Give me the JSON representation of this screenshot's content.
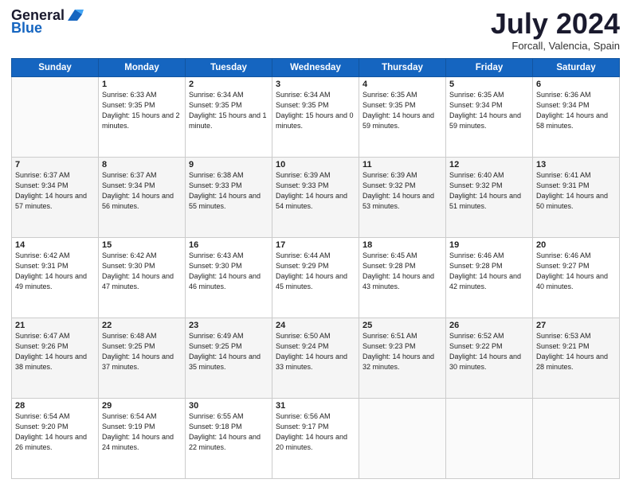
{
  "header": {
    "logo_general": "General",
    "logo_blue": "Blue",
    "month_title": "July 2024",
    "location": "Forcall, Valencia, Spain"
  },
  "days_of_week": [
    "Sunday",
    "Monday",
    "Tuesday",
    "Wednesday",
    "Thursday",
    "Friday",
    "Saturday"
  ],
  "weeks": [
    [
      {
        "day": "",
        "sunrise": "",
        "sunset": "",
        "daylight": ""
      },
      {
        "day": "1",
        "sunrise": "Sunrise: 6:33 AM",
        "sunset": "Sunset: 9:35 PM",
        "daylight": "Daylight: 15 hours and 2 minutes."
      },
      {
        "day": "2",
        "sunrise": "Sunrise: 6:34 AM",
        "sunset": "Sunset: 9:35 PM",
        "daylight": "Daylight: 15 hours and 1 minute."
      },
      {
        "day": "3",
        "sunrise": "Sunrise: 6:34 AM",
        "sunset": "Sunset: 9:35 PM",
        "daylight": "Daylight: 15 hours and 0 minutes."
      },
      {
        "day": "4",
        "sunrise": "Sunrise: 6:35 AM",
        "sunset": "Sunset: 9:35 PM",
        "daylight": "Daylight: 14 hours and 59 minutes."
      },
      {
        "day": "5",
        "sunrise": "Sunrise: 6:35 AM",
        "sunset": "Sunset: 9:34 PM",
        "daylight": "Daylight: 14 hours and 59 minutes."
      },
      {
        "day": "6",
        "sunrise": "Sunrise: 6:36 AM",
        "sunset": "Sunset: 9:34 PM",
        "daylight": "Daylight: 14 hours and 58 minutes."
      }
    ],
    [
      {
        "day": "7",
        "sunrise": "Sunrise: 6:37 AM",
        "sunset": "Sunset: 9:34 PM",
        "daylight": "Daylight: 14 hours and 57 minutes."
      },
      {
        "day": "8",
        "sunrise": "Sunrise: 6:37 AM",
        "sunset": "Sunset: 9:34 PM",
        "daylight": "Daylight: 14 hours and 56 minutes."
      },
      {
        "day": "9",
        "sunrise": "Sunrise: 6:38 AM",
        "sunset": "Sunset: 9:33 PM",
        "daylight": "Daylight: 14 hours and 55 minutes."
      },
      {
        "day": "10",
        "sunrise": "Sunrise: 6:39 AM",
        "sunset": "Sunset: 9:33 PM",
        "daylight": "Daylight: 14 hours and 54 minutes."
      },
      {
        "day": "11",
        "sunrise": "Sunrise: 6:39 AM",
        "sunset": "Sunset: 9:32 PM",
        "daylight": "Daylight: 14 hours and 53 minutes."
      },
      {
        "day": "12",
        "sunrise": "Sunrise: 6:40 AM",
        "sunset": "Sunset: 9:32 PM",
        "daylight": "Daylight: 14 hours and 51 minutes."
      },
      {
        "day": "13",
        "sunrise": "Sunrise: 6:41 AM",
        "sunset": "Sunset: 9:31 PM",
        "daylight": "Daylight: 14 hours and 50 minutes."
      }
    ],
    [
      {
        "day": "14",
        "sunrise": "Sunrise: 6:42 AM",
        "sunset": "Sunset: 9:31 PM",
        "daylight": "Daylight: 14 hours and 49 minutes."
      },
      {
        "day": "15",
        "sunrise": "Sunrise: 6:42 AM",
        "sunset": "Sunset: 9:30 PM",
        "daylight": "Daylight: 14 hours and 47 minutes."
      },
      {
        "day": "16",
        "sunrise": "Sunrise: 6:43 AM",
        "sunset": "Sunset: 9:30 PM",
        "daylight": "Daylight: 14 hours and 46 minutes."
      },
      {
        "day": "17",
        "sunrise": "Sunrise: 6:44 AM",
        "sunset": "Sunset: 9:29 PM",
        "daylight": "Daylight: 14 hours and 45 minutes."
      },
      {
        "day": "18",
        "sunrise": "Sunrise: 6:45 AM",
        "sunset": "Sunset: 9:28 PM",
        "daylight": "Daylight: 14 hours and 43 minutes."
      },
      {
        "day": "19",
        "sunrise": "Sunrise: 6:46 AM",
        "sunset": "Sunset: 9:28 PM",
        "daylight": "Daylight: 14 hours and 42 minutes."
      },
      {
        "day": "20",
        "sunrise": "Sunrise: 6:46 AM",
        "sunset": "Sunset: 9:27 PM",
        "daylight": "Daylight: 14 hours and 40 minutes."
      }
    ],
    [
      {
        "day": "21",
        "sunrise": "Sunrise: 6:47 AM",
        "sunset": "Sunset: 9:26 PM",
        "daylight": "Daylight: 14 hours and 38 minutes."
      },
      {
        "day": "22",
        "sunrise": "Sunrise: 6:48 AM",
        "sunset": "Sunset: 9:25 PM",
        "daylight": "Daylight: 14 hours and 37 minutes."
      },
      {
        "day": "23",
        "sunrise": "Sunrise: 6:49 AM",
        "sunset": "Sunset: 9:25 PM",
        "daylight": "Daylight: 14 hours and 35 minutes."
      },
      {
        "day": "24",
        "sunrise": "Sunrise: 6:50 AM",
        "sunset": "Sunset: 9:24 PM",
        "daylight": "Daylight: 14 hours and 33 minutes."
      },
      {
        "day": "25",
        "sunrise": "Sunrise: 6:51 AM",
        "sunset": "Sunset: 9:23 PM",
        "daylight": "Daylight: 14 hours and 32 minutes."
      },
      {
        "day": "26",
        "sunrise": "Sunrise: 6:52 AM",
        "sunset": "Sunset: 9:22 PM",
        "daylight": "Daylight: 14 hours and 30 minutes."
      },
      {
        "day": "27",
        "sunrise": "Sunrise: 6:53 AM",
        "sunset": "Sunset: 9:21 PM",
        "daylight": "Daylight: 14 hours and 28 minutes."
      }
    ],
    [
      {
        "day": "28",
        "sunrise": "Sunrise: 6:54 AM",
        "sunset": "Sunset: 9:20 PM",
        "daylight": "Daylight: 14 hours and 26 minutes."
      },
      {
        "day": "29",
        "sunrise": "Sunrise: 6:54 AM",
        "sunset": "Sunset: 9:19 PM",
        "daylight": "Daylight: 14 hours and 24 minutes."
      },
      {
        "day": "30",
        "sunrise": "Sunrise: 6:55 AM",
        "sunset": "Sunset: 9:18 PM",
        "daylight": "Daylight: 14 hours and 22 minutes."
      },
      {
        "day": "31",
        "sunrise": "Sunrise: 6:56 AM",
        "sunset": "Sunset: 9:17 PM",
        "daylight": "Daylight: 14 hours and 20 minutes."
      },
      {
        "day": "",
        "sunrise": "",
        "sunset": "",
        "daylight": ""
      },
      {
        "day": "",
        "sunrise": "",
        "sunset": "",
        "daylight": ""
      },
      {
        "day": "",
        "sunrise": "",
        "sunset": "",
        "daylight": ""
      }
    ]
  ]
}
